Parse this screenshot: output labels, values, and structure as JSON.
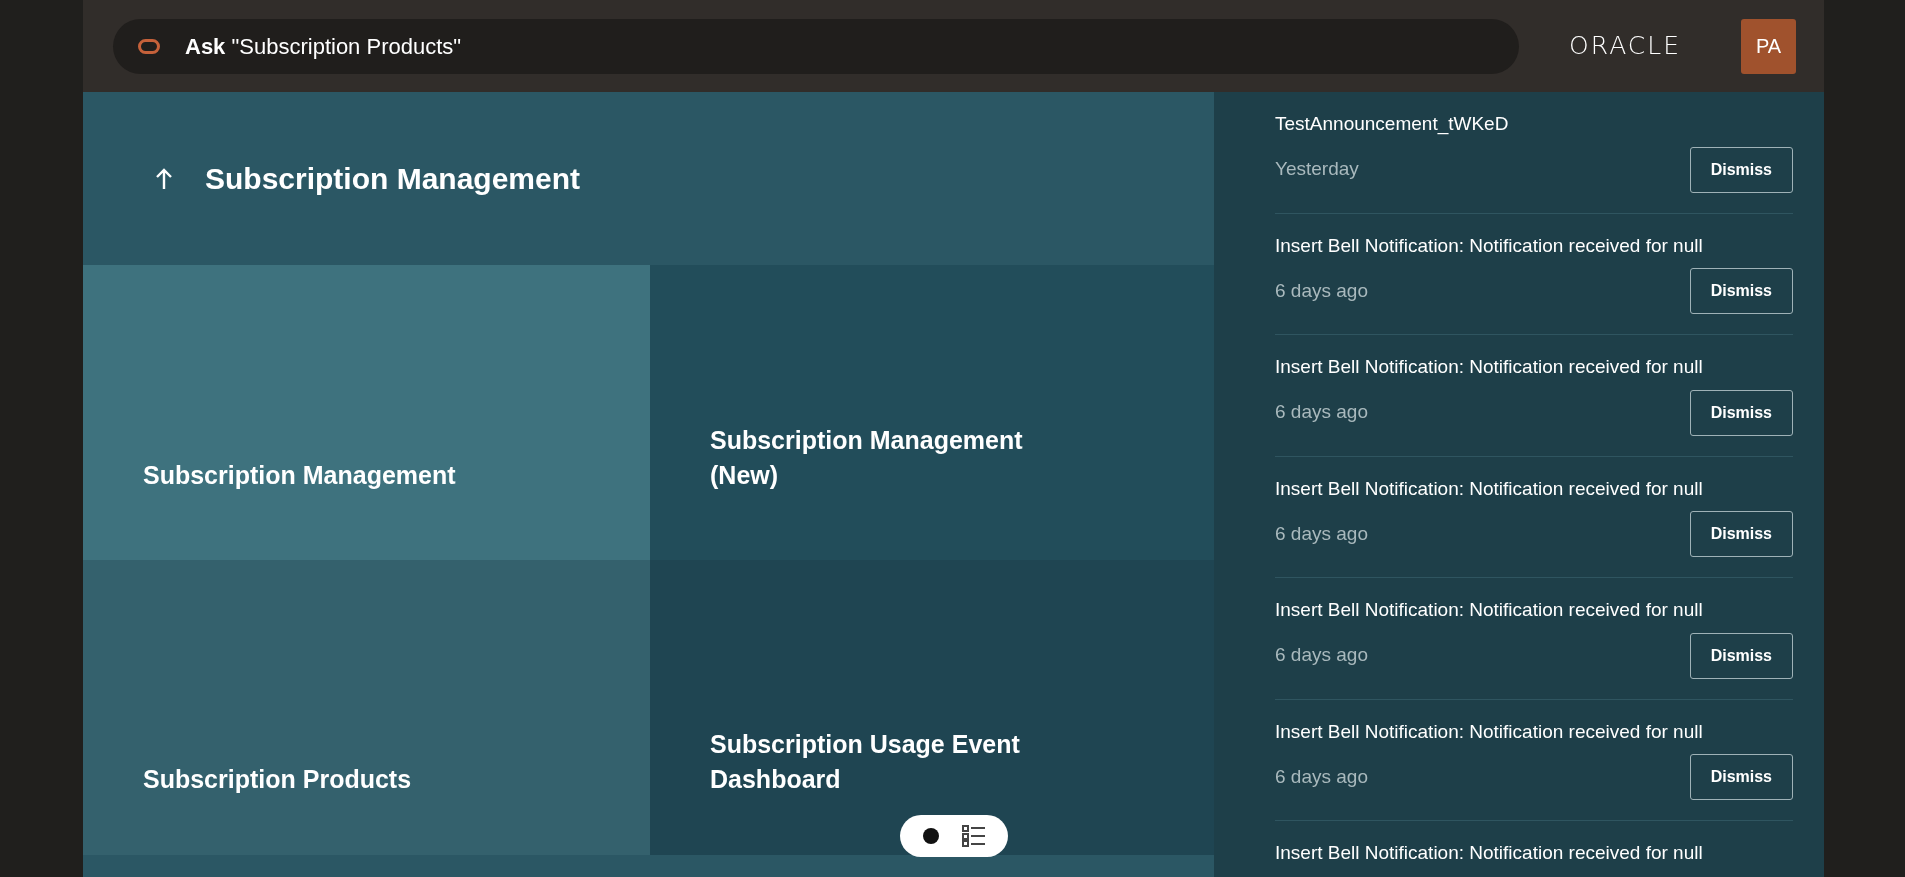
{
  "header": {
    "ask_label": "Ask",
    "search_query": "\"Subscription Products\"",
    "logo": "ORACLE",
    "avatar": "PA"
  },
  "banner": {
    "title": "Subscription Management"
  },
  "tiles": [
    {
      "label": "Subscription Management",
      "selected": true
    },
    {
      "label": "Subscription Management (New)",
      "selected": false
    },
    {
      "label": "Subscription Products",
      "selected": false
    },
    {
      "label": "Subscription Usage Event Dashboard",
      "selected": false
    }
  ],
  "view_toggle": [
    {
      "kind": "dot",
      "selected": true
    },
    {
      "kind": "list",
      "selected": false
    }
  ],
  "notifications": [
    {
      "title": "TestAnnouncement_tWKeD",
      "time": "Yesterday",
      "action": "Dismiss"
    },
    {
      "title": "Insert Bell Notification: Notification received for null",
      "time": "6 days ago",
      "action": "Dismiss"
    },
    {
      "title": "Insert Bell Notification: Notification received for null",
      "time": "6 days ago",
      "action": "Dismiss"
    },
    {
      "title": "Insert Bell Notification: Notification received for null",
      "time": "6 days ago",
      "action": "Dismiss"
    },
    {
      "title": "Insert Bell Notification: Notification received for null",
      "time": "6 days ago",
      "action": "Dismiss"
    },
    {
      "title": "Insert Bell Notification: Notification received for null",
      "time": "6 days ago",
      "action": "Dismiss"
    },
    {
      "title": "Insert Bell Notification: Notification received for null"
    }
  ]
}
